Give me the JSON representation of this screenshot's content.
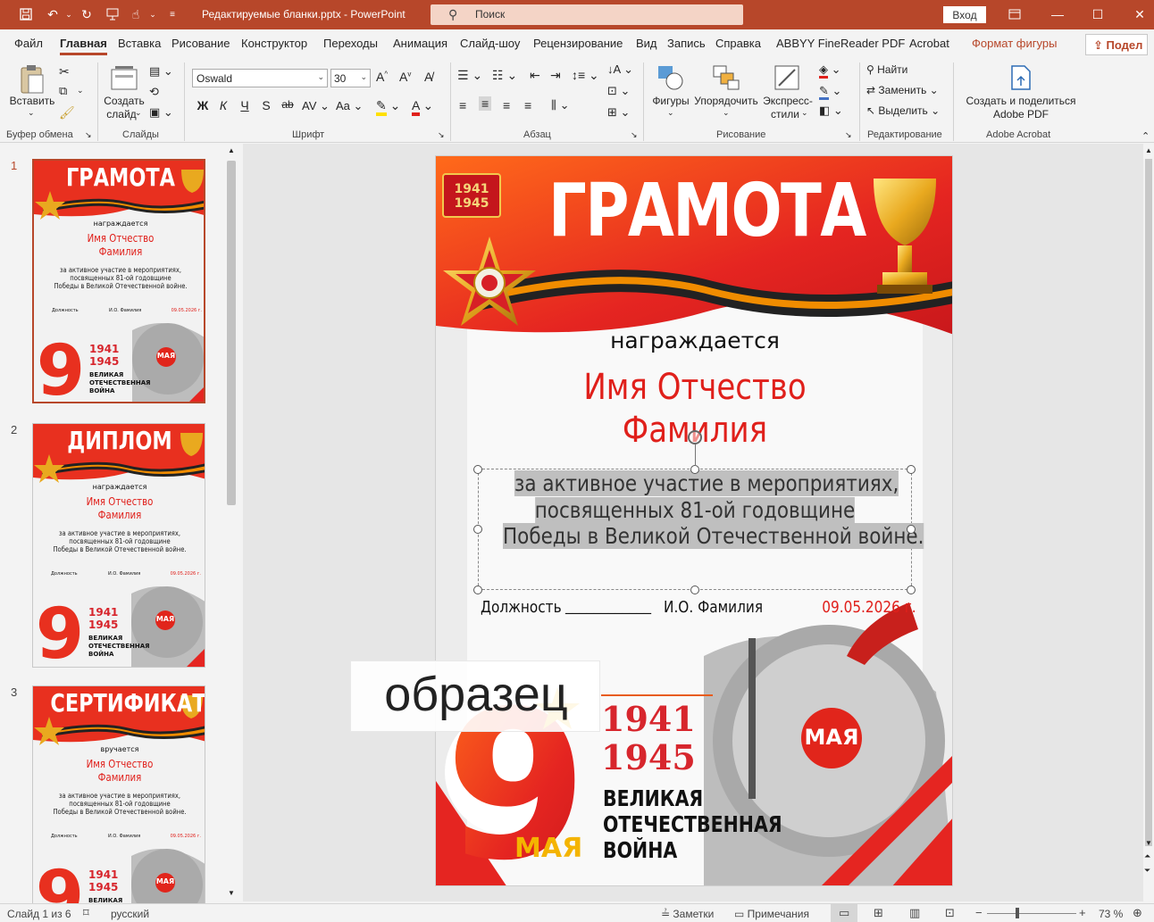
{
  "window": {
    "doc_title": "Редактируемые бланки.pptx  -  PowerPoint",
    "search_placeholder": "Поиск",
    "login_label": "Вход"
  },
  "tabs": [
    "Файл",
    "Главная",
    "Вставка",
    "Рисование",
    "Конструктор",
    "Переходы",
    "Анимация",
    "Слайд-шоу",
    "Рецензирование",
    "Вид",
    "Запись",
    "Справка",
    "ABBYY FineReader PDF",
    "Acrobat",
    "Формат фигуры"
  ],
  "active_tab": "Главная",
  "share_label": "Подел",
  "ribbon": {
    "clipboard": {
      "paste": "Вставить",
      "label": "Буфер обмена"
    },
    "slides": {
      "new_slide_1": "Создать",
      "new_slide_2": "слайд",
      "label": "Слайды"
    },
    "font": {
      "name": "Oswald",
      "size": "30",
      "label": "Шрифт",
      "bold": "Ж",
      "italic": "К",
      "underline": "Ч",
      "shadow": "S",
      "strike": "ab",
      "case": "Aa"
    },
    "paragraph": {
      "label": "Абзац"
    },
    "drawing": {
      "shapes": "Фигуры",
      "arrange": "Упорядочить",
      "quick_1": "Экспресс-",
      "quick_2": "стили",
      "label": "Рисование"
    },
    "editing": {
      "find": "Найти",
      "replace": "Заменить",
      "select": "Выделить",
      "label": "Редактирование"
    },
    "acrobat": {
      "create_1": "Создать и поделиться",
      "create_2": "Adobe PDF",
      "label": "Adobe Acrobat"
    }
  },
  "slides": [
    {
      "num": "1",
      "title": "ГРАМОТА",
      "sub": "награждается"
    },
    {
      "num": "2",
      "title": "ДИПЛОМ",
      "sub": "награждается"
    },
    {
      "num": "3",
      "title": "СЕРТИФИКАТ",
      "sub": "вручается"
    }
  ],
  "thumb_common": {
    "name1": "Имя Отчество",
    "name2": "Фамилия",
    "line1": "за активное участие в мероприятиях,",
    "line2": "посвященных 81-ой годовщине",
    "line3": "Победы в Великой Отечественной войне.",
    "position": "Должность",
    "fio": "И.О. Фамилия",
    "date": "09.05.2026 г.",
    "y1": "1941",
    "y2": "1945",
    "war1": "ВЕЛИКАЯ",
    "war2": "ОТЕЧЕСТВЕННАЯ",
    "war3": "ВОЙНА",
    "may": "МАЯ"
  },
  "slide_main": {
    "badge1": "1941",
    "badge2": "1945",
    "title": "ГРАМОТА",
    "awarded": "награждается",
    "name1": "Имя Отчество",
    "name2": "Фамилия",
    "line1": "за активное участие в мероприятиях,",
    "line2": "посвященных 81-ой годовщине",
    "line3": "Победы в Великой Отечественной войне.",
    "position": "Должность",
    "blank": "____________",
    "fio": "И.О. Фамилия",
    "date": "09.05.2026 г.",
    "watermark": "образец",
    "nine": "9",
    "y1": "1941",
    "y2": "1945",
    "war1": "ВЕЛИКАЯ",
    "war2": "ОТЕЧЕСТВЕННАЯ",
    "war3": "ВОЙНА",
    "may": "МАЯ",
    "order_text": "ОТЕЧЕСТВЕННАЯ ВОЙНА"
  },
  "status": {
    "slide_of": "Слайд 1 из 6",
    "lang": "русский",
    "notes": "Заметки",
    "comments": "Примечания",
    "zoom": "73 %"
  },
  "colors": {
    "accent": "#b7472a",
    "red": "#e0201b"
  }
}
